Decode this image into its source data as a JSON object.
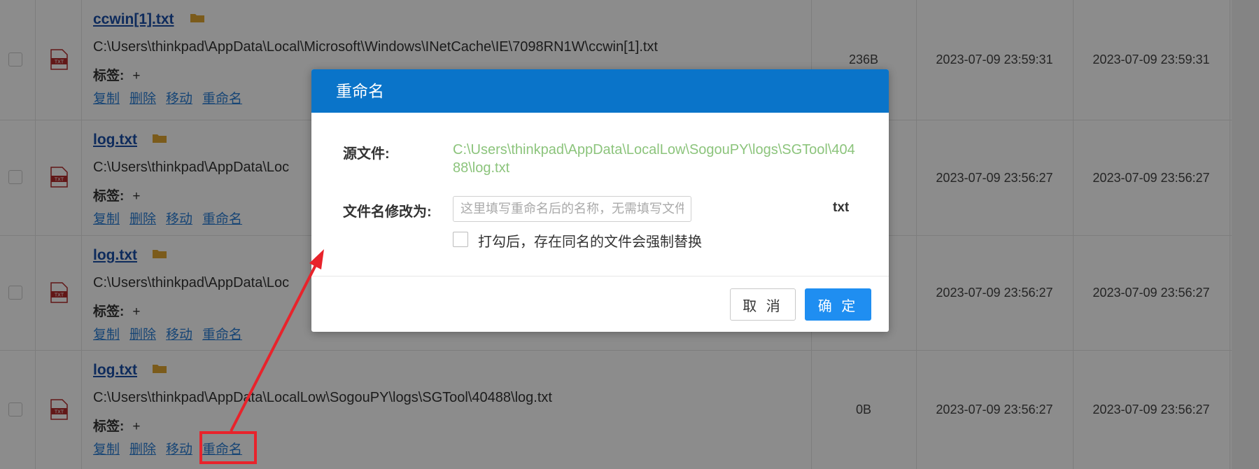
{
  "rows": [
    {
      "name": "ccwin[1].txt",
      "path": "C:\\Users\\thinkpad\\AppData\\Local\\Microsoft\\Windows\\INetCache\\IE\\7098RN1W\\ccwin[1].txt",
      "size": "236B",
      "created": "2023-07-09 23:59:31",
      "modified": "2023-07-09 23:59:31"
    },
    {
      "name": "log.txt",
      "path": "C:\\Users\\thinkpad\\AppData\\Loc",
      "size": "",
      "created": "2023-07-09 23:56:27",
      "modified": "2023-07-09 23:56:27"
    },
    {
      "name": "log.txt",
      "path": "C:\\Users\\thinkpad\\AppData\\Loc",
      "size": "",
      "created": "2023-07-09 23:56:27",
      "modified": "2023-07-09 23:56:27"
    },
    {
      "name": "log.txt",
      "path": "C:\\Users\\thinkpad\\AppData\\LocalLow\\SogouPY\\logs\\SGTool\\40488\\log.txt",
      "size": "0B",
      "created": "2023-07-09 23:56:27",
      "modified": "2023-07-09 23:56:27"
    }
  ],
  "row_labels": {
    "tags": "标签:",
    "add_tag": "+",
    "copy": "复制",
    "delete": "删除",
    "move": "移动",
    "rename": "重命名",
    "file_icon_text": "TXT"
  },
  "dialog": {
    "title": "重命名",
    "source_label": "源文件:",
    "source_path": "C:\\Users\\thinkpad\\AppData\\LocalLow\\SogouPY\\logs\\SGTool\\40488\\log.txt",
    "rename_label": "文件名修改为:",
    "rename_placeholder": "这里填写重命名后的名称，无需填写文件扩展名。",
    "extension": "txt",
    "force_replace_label": "打勾后，存在同名的文件会强制替换",
    "cancel": "取 消",
    "ok": "确 定"
  },
  "colors": {
    "dialog_header": "#0a74c9",
    "ok_button": "#1f8ef1",
    "source_path": "#8cc47c",
    "annotation": "#e8232b",
    "link": "#2b7fd6"
  }
}
